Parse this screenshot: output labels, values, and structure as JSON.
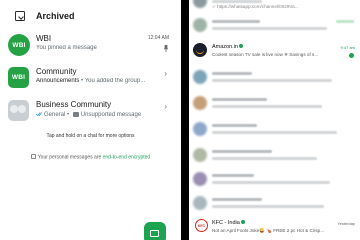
{
  "left": {
    "archived_label": "Archived",
    "chats": [
      {
        "name": "WBI",
        "avatar_text": "WBI",
        "time": "12:04 AM",
        "preview": "You pinned a message"
      },
      {
        "name": "Community",
        "avatar_text": "WBI",
        "group_label": "Announcements",
        "separator": "•",
        "preview": "You added the group..."
      },
      {
        "name": "Business Community",
        "group_label": "General",
        "separator": "•",
        "preview": "Unsupported message"
      }
    ],
    "hint": "Tap and hold on a chat for more options",
    "e2e_prefix": "Your personal messages are ",
    "e2e_link": "end-to-end encrypted"
  },
  "right": {
    "top_link_preview": "✓ https://whatsapp.com/channel/0029Va...",
    "amazon": {
      "name": "Amazon.in",
      "time": "9:47 am",
      "preview": "Coolest season TV sale is live now ❄ Savings of s..."
    },
    "kfc": {
      "name": "KFC - India",
      "time": "Yesterday",
      "preview": "Not an April Fools Joke😜 🍗 FREE 2 pc Hot & Crisp...",
      "avatar_text": "KFC"
    }
  },
  "colors": {
    "accent": "#1ca350",
    "link": "#1aa35a"
  }
}
